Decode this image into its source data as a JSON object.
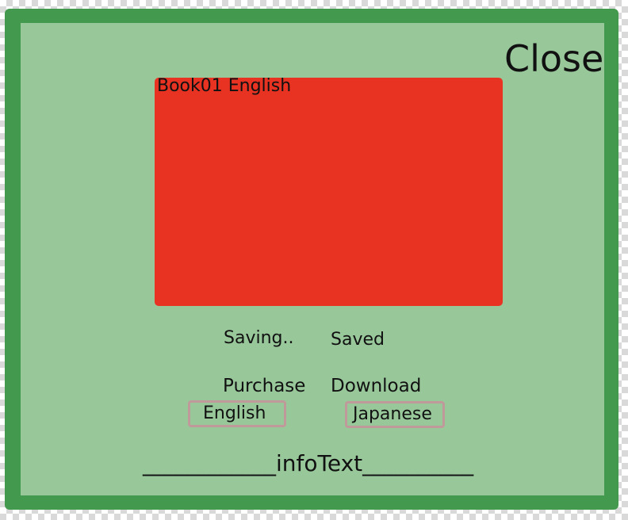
{
  "dialog": {
    "close_label": "Close",
    "preview_title": "Book01 English",
    "status": {
      "saving": "Saving..",
      "saved": "Saved"
    },
    "actions": {
      "purchase": "Purchase",
      "download": "Download"
    },
    "languages": {
      "english": "English",
      "japanese": "Japanese"
    },
    "info_text": "____________infoText__________"
  },
  "colors": {
    "frame": "#439a4e",
    "panel": "#98c79a",
    "preview": "#e83323",
    "button_border": "#c09a9a"
  }
}
